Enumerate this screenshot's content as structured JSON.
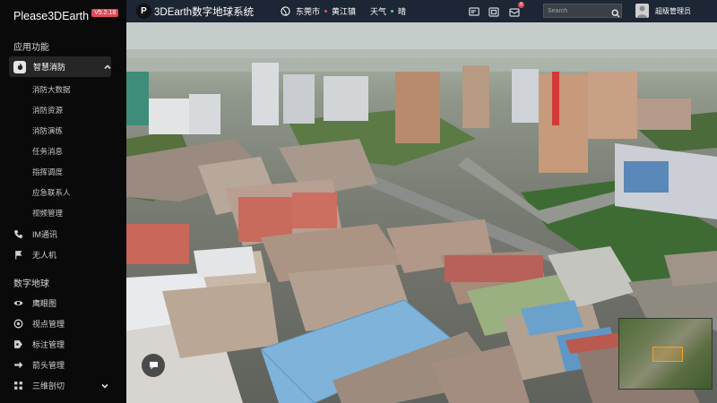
{
  "brand": {
    "name": "Please3DEarth",
    "version": "V5.2.18"
  },
  "header": {
    "system_title": "3DEarth数字地球系统",
    "logo_letter": "P",
    "location": {
      "city": "东莞市",
      "town": "黄江镇",
      "weather_label": "天气",
      "weather_value": "晴"
    },
    "notification_count": "0",
    "search": {
      "placeholder": "Search",
      "value": ""
    },
    "user": {
      "name": "超级管理员"
    }
  },
  "sidebar": {
    "section_apps": "应用功能",
    "active_group": {
      "label": "智慧消防",
      "icon": "fire-icon",
      "expanded": true
    },
    "fire_subitems": [
      "消防大数据",
      "消防资源",
      "消防演练",
      "任务消息",
      "指挥调度",
      "应急联系人",
      "视频管理"
    ],
    "apps_items": [
      {
        "label": "IM通讯",
        "icon": "phone-icon"
      },
      {
        "label": "无人机",
        "icon": "flag-icon"
      }
    ],
    "section_earth": "数字地球",
    "earth_items": [
      {
        "label": "鹰眼图",
        "icon": "eye-icon"
      },
      {
        "label": "视点管理",
        "icon": "viewpoint-icon"
      },
      {
        "label": "标注管理",
        "icon": "marker-icon"
      },
      {
        "label": "箭头管理",
        "icon": "arrow-icon"
      },
      {
        "label": "三维剖切",
        "icon": "section-icon"
      }
    ]
  },
  "colors": {
    "accent_badge": "#e04b5a",
    "topbar": "#283448",
    "sidebar": "#0a0a0a",
    "minimap_view": "#f0a030"
  }
}
